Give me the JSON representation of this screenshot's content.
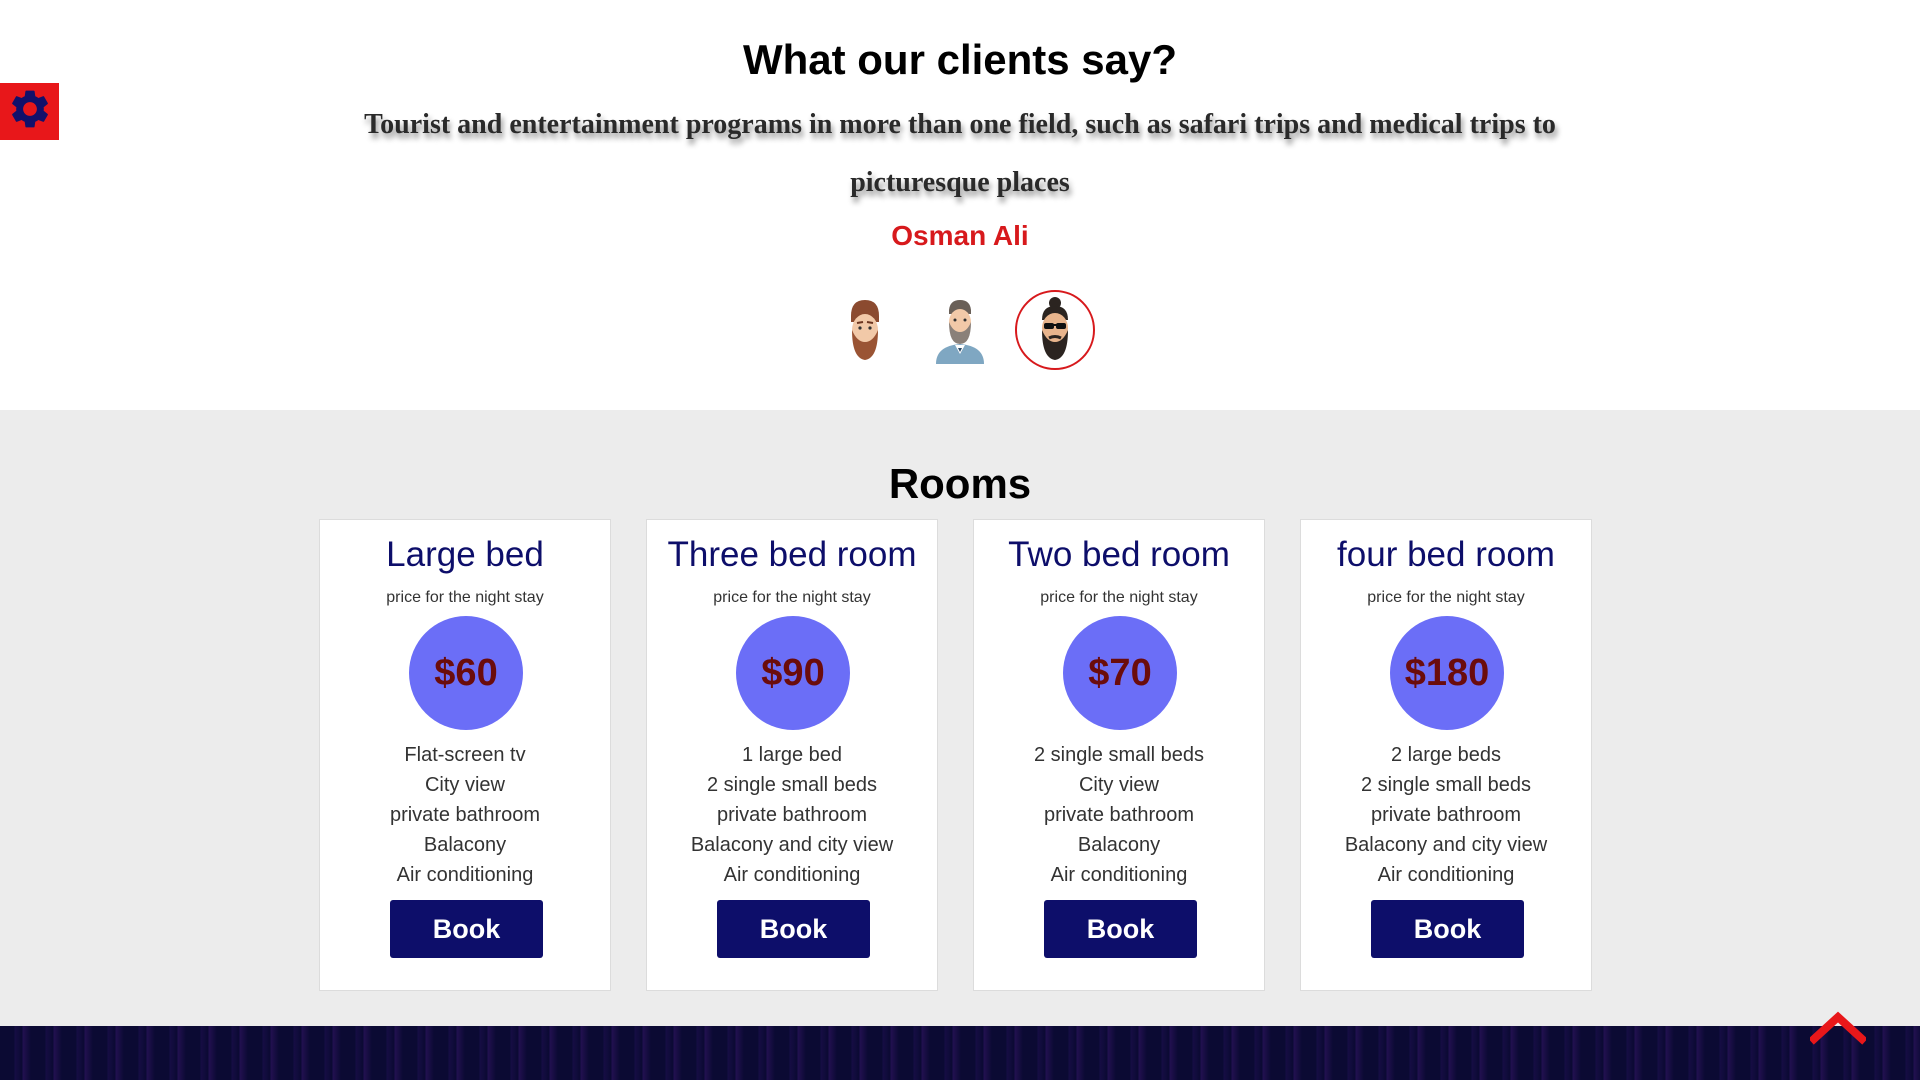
{
  "testimonials": {
    "title": "What our clients say?",
    "quote": "Tourist and entertainment programs in more than one field, such as safari trips and medical trips to picturesque places",
    "author": "Osman Ali",
    "avatars": [
      "avatar-1",
      "avatar-2",
      "avatar-3"
    ],
    "active_avatar": 3
  },
  "rooms": {
    "title": "Rooms",
    "price_caption": "price for the night stay",
    "book_label": "Book",
    "cards": [
      {
        "name": "Large bed",
        "price": "$60",
        "features": [
          "Flat-screen tv",
          "City view",
          "private bathroom",
          "Balacony",
          "Air conditioning"
        ]
      },
      {
        "name": "Three bed room",
        "price": "$90",
        "features": [
          "1 large bed",
          "2 single small beds",
          "private bathroom",
          "Balacony and city view",
          "Air conditioning"
        ]
      },
      {
        "name": "Two bed room",
        "price": "$70",
        "features": [
          "2 single small beds",
          "City view",
          "private bathroom",
          "Balacony",
          "Air conditioning"
        ]
      },
      {
        "name": "four bed room",
        "price": "$180",
        "features": [
          "2 large beds",
          "2 single small beds",
          "private bathroom",
          "Balacony and city view",
          "Air conditioning"
        ]
      }
    ]
  },
  "icons": {
    "settings": "gear-icon",
    "scroll_top": "chevron-up-icon"
  },
  "colors": {
    "accent_red": "#d7191c",
    "navy": "#0d0e6a",
    "price_circle": "#6b6ef7",
    "price_text": "#6b0c0c",
    "rooms_bg": "#ececec",
    "footer_bg": "#0b0a33"
  }
}
